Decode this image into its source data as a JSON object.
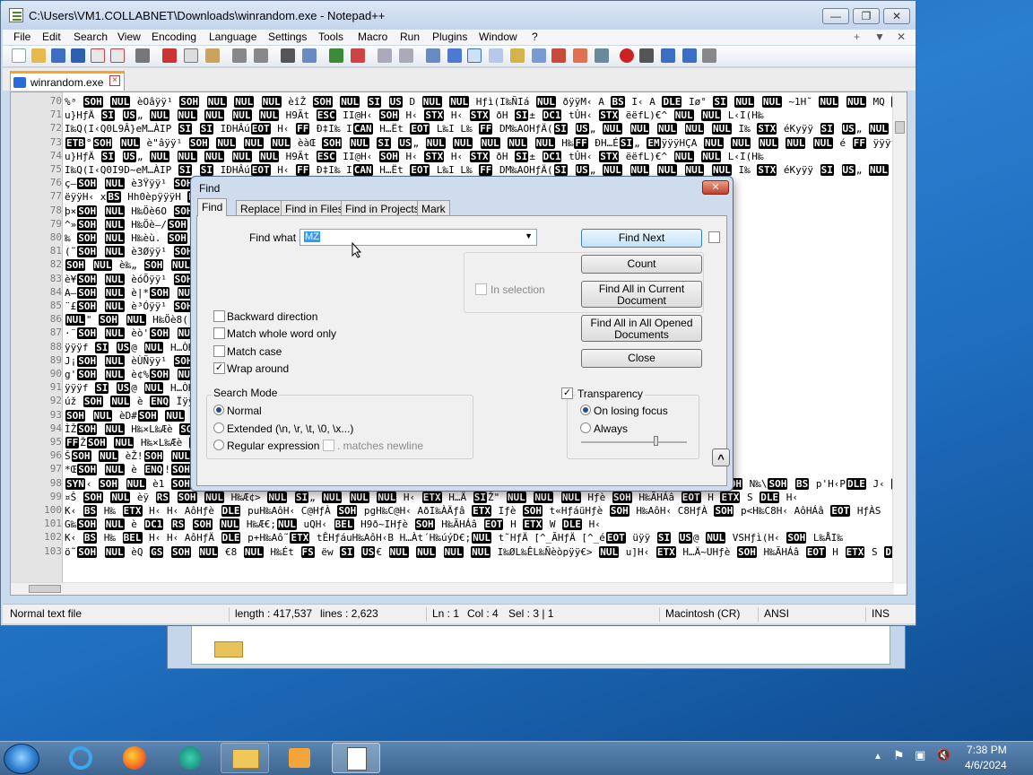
{
  "window": {
    "title": "C:\\Users\\VM1.COLLABNET\\Downloads\\winrandom.exe - Notepad++",
    "min": "—",
    "max": "❐",
    "close": "✕"
  },
  "menu": [
    "File",
    "Edit",
    "Search",
    "View",
    "Encoding",
    "Language",
    "Settings",
    "Tools",
    "Macro",
    "Run",
    "Plugins",
    "Window",
    "?"
  ],
  "menu_right": {
    "plus": "+",
    "down": "▼",
    "close": "✕"
  },
  "tab": {
    "label": "winrandom.exe",
    "close": "×"
  },
  "editor": {
    "lines": [
      {
        "n": "70",
        "t": "%ᵃ SOH NUL èOâÿÿ¹ SOH NUL NUL NUL èîŽ SOH NUL SI US D NUL NUL Hƒì(I‰ÑIá NUL ðÿÿM‹ A BS I‹ A DLE Iø° SI NUL NUL ~1H˜ NUL NUL MQ CAN H9A SI„ NUL"
      },
      {
        "n": "71",
        "t": "u}HƒÄ SI US„ NUL NUL NUL NUL NUL H9Ãt ESC II@H‹ SOH H‹ STX H‹ STX ðH SI± DC1 tÛH‹ STX ëëfL)€^ NUL NUL L‹I(H‰"
      },
      {
        "n": "72",
        "t": "I‰Q(I‹Q0L9Â}eM…ÀIP SI SI IÐHÂúEOT H‹ FF Ð‡I‰ ICAN H…Ët EOT L‰I L‰ FF DM‰AOHƒÄ(SI US„ NUL NUL NUL NUL NUL I‰ STX éKyÿÿ SI US„ NUL"
      },
      {
        "n": "73",
        "t": "ETB°SOH NUL è\"âÿÿ¹ SOH NUL NUL NUL èàŒ SOH NUL SI US„ NUL NUL NUL NUL NUL H‰FF ÐH…ÉSI„ EMÿÿÿHÇA NUL NUL NUL NUL NUL é FF ÿÿÿf SI US D NUL NUL"
      },
      {
        "n": "74",
        "t": "u}HƒÄ SI US„ NUL NUL NUL NUL NUL H9Ãt ESC II@H‹ SOH H‹ STX H‹ STX ðH SI± DC1 tÛH‹ STX ëëfL)€^ NUL NUL L‹I(H‰"
      },
      {
        "n": "75",
        "t": "I‰Q(I‹Q0I9D~eM…ÀIP SI SI IÐHÂúEOT H‹ FF Ð‡I‰ ICAN H…Ët EOT L‰I L‰ FF DM‰AOHƒÄ(SI US„ NUL NUL NUL NUL NUL I‰ STX éKyÿÿ SI US„ NUL"
      },
      {
        "n": "76",
        "t": "ç–SOH NUL è3Ÿÿÿ¹ SOH NUL NUL NUL è FF ÿÿÿf SI US D NUL NUL A"
      },
      {
        "n": "77",
        "t": "ëÿÿH‹ xBS Hh0èpÿÿÿH NUL NUL NUL H‰ÜHú NUL NUL NUL ?DEL ©e"
      },
      {
        "n": "78",
        "t": "þ×SOH NUL H‰Öè6O SOH NUL H‰ÜH‰"
      },
      {
        "n": "79",
        "t": "^»SOH NUL H‰Öè–/SOH NUL H‰ÜH‰"
      },
      {
        "n": "80",
        "t": "‰ SOH NUL H‰èù. SOH NUL STX I‹ STX ðL SI± u}Hƒ"
      },
      {
        "n": "81",
        "t": "(˜SOH NUL è3Øÿÿ¹ SOH NUL DC3 ÿÿÿf SI US D NUL NUL"
      },
      {
        "n": "82",
        "t": "SOH NUL è‰„ SOH NUL I‹ STX ðL SI± u}HƒÄ  ["
      },
      {
        "n": "83",
        "t": "è¥SOH NUL èóÕÿÿ¹ SOH NUL DC3 ÿÿÿf SI US D NUL NUL"
      },
      {
        "n": "84",
        "t": "A–SOH NUL è|*SOH NUL STX I‹ STX ðL SI±    u}Hƒ"
      },
      {
        "n": "85",
        "t": "¨£SOH NUL è³Óÿÿ¹ SOH NUL DC3 ÿÿÿf SI US D NUL NUL"
      },
      {
        "n": "86",
        "t": "NUL\" SOH NUL H‰Öè8( NUL ëH…ötWH"
      },
      {
        "n": "87",
        "t": "·¨SOH NUL èò'SOH NUL STX I‹ STX ðL SI±   SI…C"
      },
      {
        "n": "88",
        "t": "ÿÿÿf SI US@ NUL H…ÒHB NUL NUL H…Aud SI US@ NUL NUL"
      },
      {
        "n": "89",
        "t": "J¡SOH NUL èÙÑÿÿ¹ SOH NUL NUL NUL I‰ËHÓáIÁû ACK H÷"
      },
      {
        "n": "90",
        "t": "g'SOH NUL è¢%SOH NUL STX I‹ STX ðL SI±   SI…C"
      },
      {
        "n": "91",
        "t": "ÿÿÿf SI US@ NUL H…ÒHB NUL NUL H…Aud SI US@ NUL NUL"
      },
      {
        "n": "92",
        "t": "úž SOH NUL è ENQ Ïÿÿ¹ SOH NUL NUL NUL I‰ËHÓáIÁû ACK H÷"
      },
      {
        "n": "93",
        "t": "   SOH NUL èD#SOH NUL H‰ÎH"
      },
      {
        "n": "94",
        "t": "ÌŽSOH NUL H‰×L‰Æè SOH NUL ÒAL9ÂL SI NÃèøz SOH NUL"
      },
      {
        "n": "95",
        "t": "FFŽSOH NUL H‰×L‰Æè SOH NUL OÀL9ÂL SI NÃè8z SOH NUL"
      },
      {
        "n": "96",
        "t": "ŠSOH NUL èŽ!SOH NUL DC1 @ DLE A„ SOH NUL NUL"
      },
      {
        "n": "97",
        "t": "*ŒSOH NUL è ENQ!SOH NUL [^Ãf SI US„ NUL NUL NUL NUL"
      },
      {
        "n": "98",
        "t": "SYN‹ SOH NUL è1  SOH NUL H‹ DLE HƒèSOH pNH‹ H DLE HÄâEOT I‰ØIÁàEOT HƒÄSOH L‹ DC4 DC1 L‹\\DC1 BS N‰ DC4 SOH N‰\\SOH BS p'H‹PDLE J‹ DC4 STX"
      },
      {
        "n": "99",
        "t": "¤Š SOH NUL èÿ RS SOH NUL H‰Æ¢> NUL SI„  NUL NUL NUL H‹ ETX H…Ä SIŽ\" NUL NUL NUL Hƒè SOH H‰ÃHÁâ EOT H ETX S DLE H‹"
      },
      {
        "n": "100",
        "t": "K‹ BS H‰ ETX H‹   H‹ AôHƒè DLE puH‰AôH‹ C@HƒÀ SOH pgH‰C@H‹ AðI‰ÀÄƒâ ETX Iƒè SOH t«HƒáüHƒè SOH H‰AôH‹ C8HƒÀ SOH p<H‰C8H‹ AôHÁâ EOT HƒÀS"
      },
      {
        "n": "101",
        "t": "G‰SOH NUL è DC1 RS SOH NUL H‰Æ€;NUL uQH‹ BEL H9ð~IHƒè SOH H‰ÃHÁâ EOT H ETX W DLE H‹"
      },
      {
        "n": "102",
        "t": "K‹ BS H‰ BEL H‹   H‹ AôHƒÄ DLE p+H‰Aô˜ETX tÊHƒáuH‰AôH‹B H…Àt´H‰úýD€;NUL t˜HƒÄ [^_ÃHƒÄ [^_éEOT üÿÿ SI US@ NUL VSHƒì(H‹ SOH L‰ÅI‰"
      },
      {
        "n": "103",
        "t": "ö˜SOH NUL èQ GS SOH NUL €8 NUL H‰Ét FS ëw SI US€ NUL NUL NUL NUL I‰ØL‰ÊL‰Ñèòpÿÿ€> NUL u]H‹ ETX H…Ä~UHƒè SOH H‰ÃHÁâ EOT H ETX S DLE H‹"
      }
    ]
  },
  "status": {
    "type": "Normal text file",
    "length": "length : 417,537",
    "lines": "lines : 2,623",
    "ln": "Ln : 1",
    "col": "Col : 4",
    "sel": "Sel : 3 | 1",
    "eol": "Macintosh (CR)",
    "encoding": "ANSI",
    "mode": "INS"
  },
  "dialog": {
    "title": "Find",
    "close": "✕",
    "tabs": [
      "Find",
      "Replace",
      "Find in Files",
      "Find in Projects",
      "Mark"
    ],
    "find_what_label": "Find what :",
    "find_what_value": "MZ",
    "buttons": {
      "find_next": "Find Next",
      "count": "Count",
      "find_all_current": "Find All in Current Document",
      "find_all_opened": "Find All in All Opened Documents",
      "close": "Close"
    },
    "in_selection": "In selection",
    "options": [
      {
        "label": "Backward direction",
        "checked": false
      },
      {
        "label": "Match whole word only",
        "checked": false
      },
      {
        "label": "Match case",
        "checked": false
      },
      {
        "label": "Wrap around",
        "checked": true
      }
    ],
    "search_mode": {
      "label": "Search Mode",
      "normal": "Normal",
      "extended": "Extended (\\n, \\r, \\t, \\0, \\x...)",
      "regex": "Regular expression",
      "matches_newline": ". matches newline"
    },
    "transparency": {
      "label": "Transparency",
      "on_losing_focus": "On losing focus",
      "always": "Always"
    },
    "collapse": "^"
  },
  "taskbar": {
    "time": "7:38 PM",
    "date": "4/6/2024"
  }
}
